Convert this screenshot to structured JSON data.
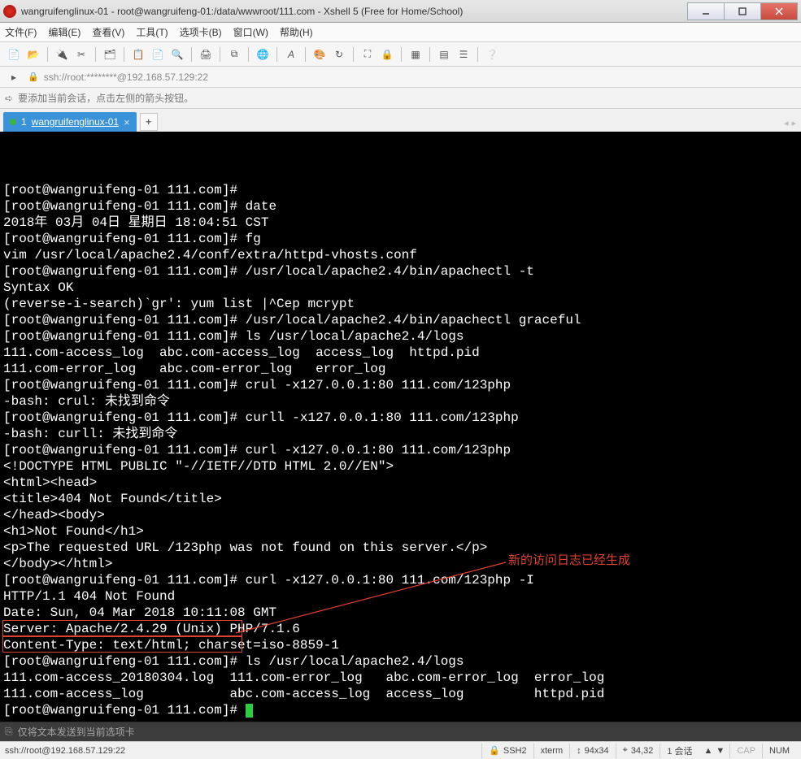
{
  "window": {
    "title": "wangruifenglinux-01 - root@wangruifeng-01:/data/wwwroot/111.com - Xshell 5 (Free for Home/School)"
  },
  "menu": {
    "file": "文件(F)",
    "edit": "编辑(E)",
    "view": "查看(V)",
    "tools": "工具(T)",
    "tabs": "选项卡(B)",
    "window": "窗口(W)",
    "help": "帮助(H)"
  },
  "address": {
    "text": "ssh://root:********@192.168.57.129:22"
  },
  "hint": {
    "text": "要添加当前会话，点击左侧的箭头按钮。"
  },
  "tab": {
    "index": "1",
    "label": "wangruifenglinux-01",
    "add": "+"
  },
  "terminal_lines": [
    "[root@wangruifeng-01 111.com]# ",
    "[root@wangruifeng-01 111.com]# date",
    "2018年 03月 04日 星期日 18:04:51 CST",
    "[root@wangruifeng-01 111.com]# fg",
    "vim /usr/local/apache2.4/conf/extra/httpd-vhosts.conf",
    "[root@wangruifeng-01 111.com]# /usr/local/apache2.4/bin/apachectl -t",
    "Syntax OK",
    "(reverse-i-search)`gr': yum list |^Cep mcrypt",
    "[root@wangruifeng-01 111.com]# /usr/local/apache2.4/bin/apachectl graceful",
    "[root@wangruifeng-01 111.com]# ls /usr/local/apache2.4/logs",
    "111.com-access_log  abc.com-access_log  access_log  httpd.pid",
    "111.com-error_log   abc.com-error_log   error_log",
    "[root@wangruifeng-01 111.com]# crul -x127.0.0.1:80 111.com/123php",
    "-bash: crul: 未找到命令",
    "[root@wangruifeng-01 111.com]# curll -x127.0.0.1:80 111.com/123php",
    "-bash: curll: 未找到命令",
    "[root@wangruifeng-01 111.com]# curl -x127.0.0.1:80 111.com/123php",
    "<!DOCTYPE HTML PUBLIC \"-//IETF//DTD HTML 2.0//EN\">",
    "<html><head>",
    "<title>404 Not Found</title>",
    "</head><body>",
    "<h1>Not Found</h1>",
    "<p>The requested URL /123php was not found on this server.</p>",
    "</body></html>",
    "[root@wangruifeng-01 111.com]# curl -x127.0.0.1:80 111.com/123php -I",
    "HTTP/1.1 404 Not Found",
    "Date: Sun, 04 Mar 2018 10:11:08 GMT",
    "Server: Apache/2.4.29 (Unix) PHP/7.1.6",
    "Content-Type: text/html; charset=iso-8859-1",
    "",
    "[root@wangruifeng-01 111.com]# ls /usr/local/apache2.4/logs",
    "111.com-access_20180304.log  111.com-error_log   abc.com-error_log  error_log",
    "111.com-access_log           abc.com-access_log  access_log         httpd.pid",
    "[root@wangruifeng-01 111.com]# "
  ],
  "annotation": {
    "text": "新的访问日志已经生成"
  },
  "inputbar": {
    "text": "仅将文本发送到当前选项卡"
  },
  "status": {
    "conn": "ssh://root@192.168.57.129:22",
    "proto": "SSH2",
    "term": "xterm",
    "size": "94x34",
    "pos": "34,32",
    "sessions": "1 会话",
    "cap": "CAP",
    "num": "NUM"
  }
}
